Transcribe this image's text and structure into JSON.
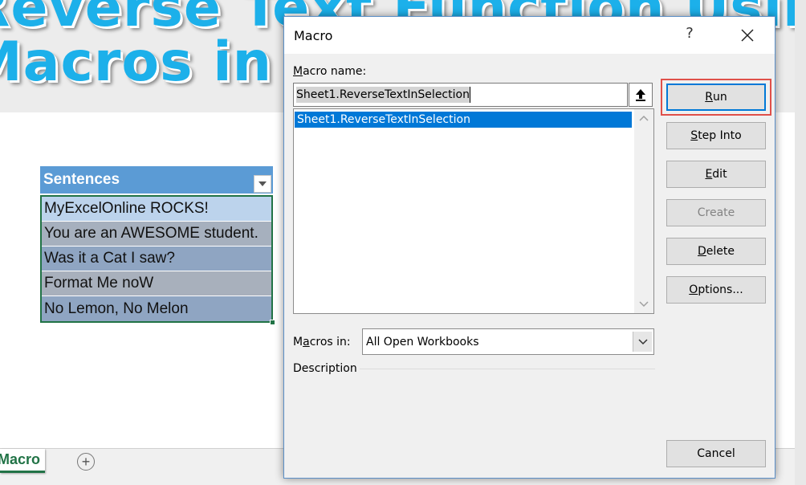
{
  "background": {
    "banner_line1": "Reverse Text Function Using",
    "banner_line2": "Macros in Excel",
    "table": {
      "header": "Sentences",
      "rows": [
        "MyExcelOnline ROCKS!",
        "You are an AWESOME student.",
        "Was it a Cat I saw?",
        "Format Me noW",
        "No Lemon, No Melon"
      ]
    },
    "sheet_tab": "Macro",
    "add_sheet_symbol": "+"
  },
  "dialog": {
    "title": "Macro",
    "help_symbol": "?",
    "macro_name_label_access": "M",
    "macro_name_label_rest": "acro name:",
    "macro_name_value": "Sheet1.ReverseTextInSelection",
    "macro_list": [
      "Sheet1.ReverseTextInSelection"
    ],
    "buttons": {
      "run_access": "R",
      "run_rest": "un",
      "step_into_access": "S",
      "step_into_rest": "tep Into",
      "edit_access": "E",
      "edit_rest": "dit",
      "create": "Create",
      "delete_access": "D",
      "delete_rest": "elete",
      "options_access": "O",
      "options_rest": "ptions...",
      "cancel": "Cancel"
    },
    "macros_in_label_pre": "M",
    "macros_in_label_access": "a",
    "macros_in_label_rest": "cros in:",
    "macros_in_value": "All Open Workbooks",
    "description_label": "Description"
  },
  "colors": {
    "accent": "#0078d7",
    "highlight_outline": "#e0504a",
    "table_header": "#5b9bd5",
    "excel_green": "#217346"
  }
}
